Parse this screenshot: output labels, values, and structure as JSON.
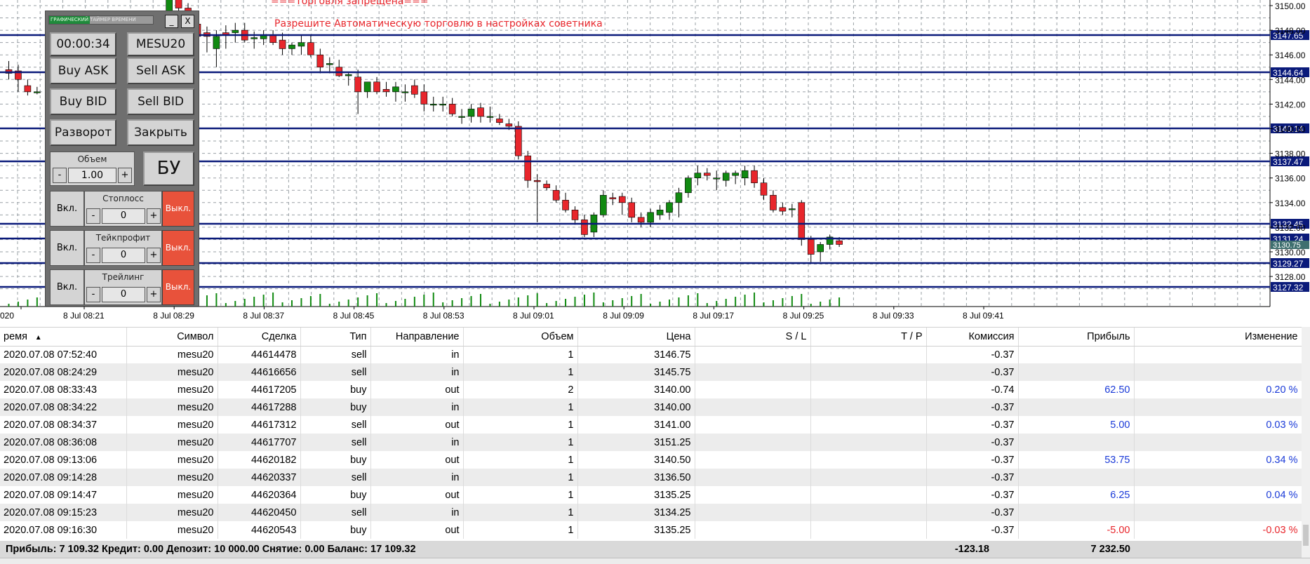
{
  "chart": {
    "warning_title": "===Торговля запрещена===",
    "warning_text": "Разрешите Автоматическую торговлю в настройках советника",
    "price_ticks": [
      "3150.00",
      "3148.00",
      "3146.00",
      "3144.00",
      "3142.00",
      "3140.00",
      "3138.00",
      "3136.00",
      "3134.00",
      "3132.00",
      "3130.00",
      "3128.00"
    ],
    "levels": [
      "3147.65",
      "3144.64",
      "3140.14",
      "3137.47",
      "3132.45",
      "3131.24",
      "3129.27",
      "3127.32"
    ],
    "bid_label": "3130.75",
    "time_ticks": [
      "020",
      "8 Jul 08:21",
      "8 Jul 08:29",
      "8 Jul 08:37",
      "8 Jul 08:45",
      "8 Jul 08:53",
      "8 Jul 09:01",
      "8 Jul 09:09",
      "8 Jul 09:17",
      "8 Jul 09:25",
      "8 Jul 09:33",
      "8 Jul 09:41"
    ],
    "colors": {
      "bull": "#118a11",
      "bear": "#e8262c",
      "level": "#0a1a7a",
      "grid": "#9aa0a6"
    }
  },
  "panel": {
    "title_green": "ГРАФИЧЕСКИЙ",
    "title_rest": "ТАЙМЕР ВРЕМЕНИ",
    "min_label": "_",
    "close_label": "X",
    "timer": "00:00:34",
    "symbol": "MESU20",
    "buy_ask": "Buy ASK",
    "sell_ask": "Sell ASK",
    "buy_bid": "Buy BID",
    "sell_bid": "Sell BID",
    "reverse": "Разворот",
    "close": "Закрыть",
    "volume_label": "Объем",
    "volume_value": "1.00",
    "minus": "-",
    "plus": "+",
    "bu": "БУ",
    "on": "Вкл.",
    "off": "Выкл.",
    "stoploss_label": "Стоплосс",
    "takeprofit_label": "Тейкпрофит",
    "trailing_label": "Трейлинг",
    "zero": "0"
  },
  "table": {
    "headers": [
      "ремя",
      "Символ",
      "Сделка",
      "Тип",
      "Направление",
      "Объем",
      "Цена",
      "S / L",
      "T / P",
      "Комиссия",
      "Прибыль",
      "Изменение"
    ],
    "sort_arrow": "▲",
    "rows": [
      [
        "2020.07.08 07:52:40",
        "mesu20",
        "44614478",
        "sell",
        "in",
        "1",
        "3146.75",
        "",
        "",
        "-0.37",
        "",
        ""
      ],
      [
        "2020.07.08 08:24:29",
        "mesu20",
        "44616656",
        "sell",
        "in",
        "1",
        "3145.75",
        "",
        "",
        "-0.37",
        "",
        ""
      ],
      [
        "2020.07.08 08:33:43",
        "mesu20",
        "44617205",
        "buy",
        "out",
        "2",
        "3140.00",
        "",
        "",
        "-0.74",
        "62.50",
        "0.20 %"
      ],
      [
        "2020.07.08 08:34:22",
        "mesu20",
        "44617288",
        "buy",
        "in",
        "1",
        "3140.00",
        "",
        "",
        "-0.37",
        "",
        ""
      ],
      [
        "2020.07.08 08:34:37",
        "mesu20",
        "44617312",
        "sell",
        "out",
        "1",
        "3141.00",
        "",
        "",
        "-0.37",
        "5.00",
        "0.03 %"
      ],
      [
        "2020.07.08 08:36:08",
        "mesu20",
        "44617707",
        "sell",
        "in",
        "1",
        "3151.25",
        "",
        "",
        "-0.37",
        "",
        ""
      ],
      [
        "2020.07.08 09:13:06",
        "mesu20",
        "44620182",
        "buy",
        "out",
        "1",
        "3140.50",
        "",
        "",
        "-0.37",
        "53.75",
        "0.34 %"
      ],
      [
        "2020.07.08 09:14:28",
        "mesu20",
        "44620337",
        "sell",
        "in",
        "1",
        "3136.50",
        "",
        "",
        "-0.37",
        "",
        ""
      ],
      [
        "2020.07.08 09:14:47",
        "mesu20",
        "44620364",
        "buy",
        "out",
        "1",
        "3135.25",
        "",
        "",
        "-0.37",
        "6.25",
        "0.04 %"
      ],
      [
        "2020.07.08 09:15:23",
        "mesu20",
        "44620450",
        "sell",
        "in",
        "1",
        "3134.25",
        "",
        "",
        "-0.37",
        "",
        ""
      ],
      [
        "2020.07.08 09:16:30",
        "mesu20",
        "44620543",
        "buy",
        "out",
        "1",
        "3135.25",
        "",
        "",
        "-0.37",
        "-5.00",
        "-0.03 %"
      ]
    ]
  },
  "summary": {
    "text": "Прибыль: 7 109.32  Кредит: 0.00  Депозит: 10 000.00  Снятие: 0.00  Баланс: 17 109.32",
    "commission_total": "-123.18",
    "profit_total": "7 232.50"
  }
}
